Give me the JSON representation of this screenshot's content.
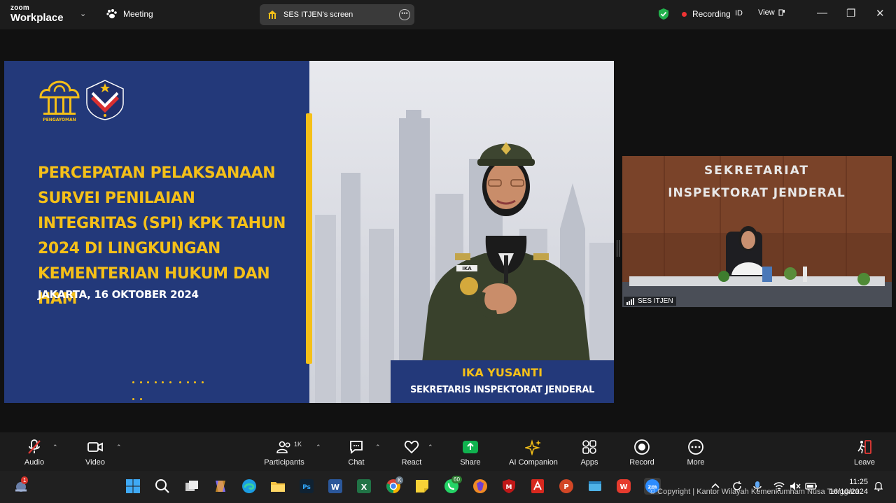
{
  "titlebar": {
    "brand_line1": "zoom",
    "brand_line2": "Workplace",
    "meeting_label": "Meeting",
    "screen_share_label": "SES ITJEN's screen",
    "recording_label": "Recording",
    "id_label": "ID",
    "view_label": "View"
  },
  "slide": {
    "logo_caption": "PENGAYOMAN",
    "title": "PERCEPATAN PELAKSANAAN SURVEI PENILAIAN INTEGRITAS (SPI) KPK TAHUN 2024 DI LINGKUNGAN KEMENTERIAN HUKUM DAN HAM",
    "date": "JAKARTA, 16 OKTOBER 2024",
    "speaker_name": "IKA YUSANTI",
    "speaker_role": "SEKRETARIS INSPEKTORAT JENDERAL",
    "name_tag": "IKA",
    "accent_color": "#f5c018",
    "panel_color": "#23397a"
  },
  "participant_tile": {
    "wall_line1": "SEKRETARIAT",
    "wall_line2": "INSPEKTORAT JENDERAL",
    "name": "SES ITJEN"
  },
  "toolbar": {
    "audio": "Audio",
    "video": "Video",
    "participants": "Participants",
    "participants_count": "1K",
    "chat": "Chat",
    "react": "React",
    "share": "Share",
    "ai_companion": "AI Companion",
    "apps": "Apps",
    "record": "Record",
    "more": "More",
    "leave": "Leave"
  },
  "taskbar": {
    "notification_badge": "1",
    "chrome_badge": "K",
    "whatsapp_badge": "60",
    "time": "11:25",
    "date": "16/10/2024",
    "copyright": "© Copyright | Kantor Wilayah Kemenkumham Nusa Tenggara"
  }
}
